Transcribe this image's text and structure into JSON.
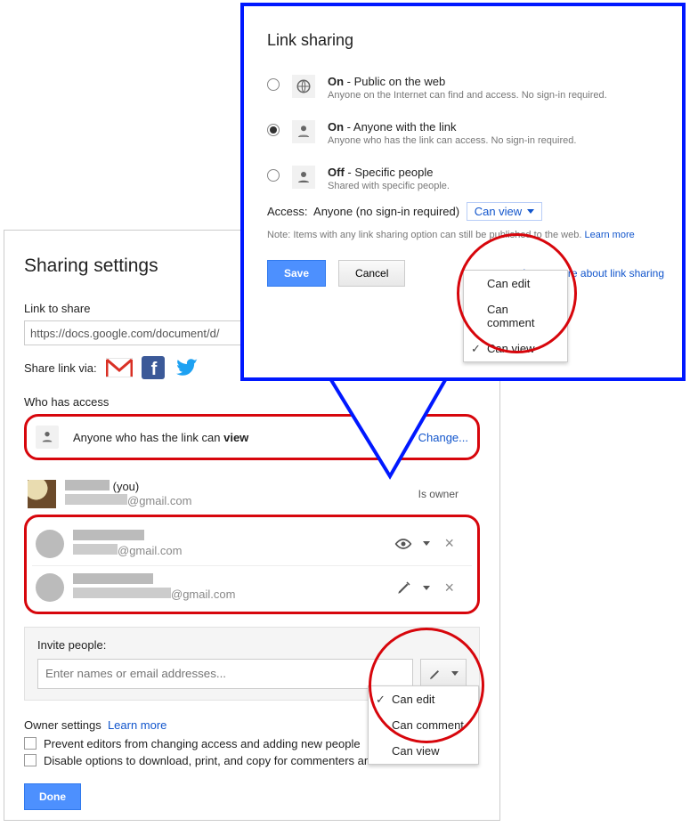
{
  "sharing_panel": {
    "title": "Sharing settings",
    "link_label": "Link to share",
    "share_url": "https://docs.google.com/document/d/",
    "share_via_label": "Share link via:",
    "who_has_access_title": "Who has access",
    "access_summary_prefix": "Anyone who has the link can ",
    "access_summary_perm": "view",
    "change_label": "Change...",
    "owner_you_suffix": "(you)",
    "owner_email_suffix": "@gmail.com",
    "owner_perm_label": "Is owner",
    "shared_users": [
      {
        "email_suffix": "@gmail.com",
        "perm": "view"
      },
      {
        "email_suffix": "@gmail.com",
        "perm": "edit"
      }
    ],
    "invite_label": "Invite people:",
    "invite_placeholder": "Enter names or email addresses...",
    "invite_menu": {
      "items": [
        "Can edit",
        "Can comment",
        "Can view"
      ],
      "selected": "Can edit"
    },
    "owner_settings_label": "Owner settings",
    "learn_more_label": "Learn more",
    "checkbox1": "Prevent editors from changing access and adding new people",
    "checkbox2": "Disable options to download, print, and copy for commenters and viewers",
    "done_label": "Done"
  },
  "link_sharing_popup": {
    "title": "Link sharing",
    "options": [
      {
        "state": "On",
        "label": "Public on the web",
        "desc": "Anyone on the Internet can find and access. No sign-in required.",
        "checked": false
      },
      {
        "state": "On",
        "label": "Anyone with the link",
        "desc": "Anyone who has the link can access. No sign-in required.",
        "checked": true
      },
      {
        "state": "Off",
        "label": "Specific people",
        "desc": "Shared with specific people.",
        "checked": false
      }
    ],
    "access_prefix": "Access:",
    "access_who": "Anyone (no sign-in required)",
    "access_dd_label": "Can view",
    "access_menu": {
      "items": [
        "Can edit",
        "Can comment",
        "Can view"
      ],
      "selected": "Can view"
    },
    "note_prefix": "Note: Items with any link sharing option can still be published to the web. ",
    "note_link": "Learn more",
    "save_label": "Save",
    "cancel_label": "Cancel",
    "learn_more_about": "Learn more about link sharing"
  }
}
